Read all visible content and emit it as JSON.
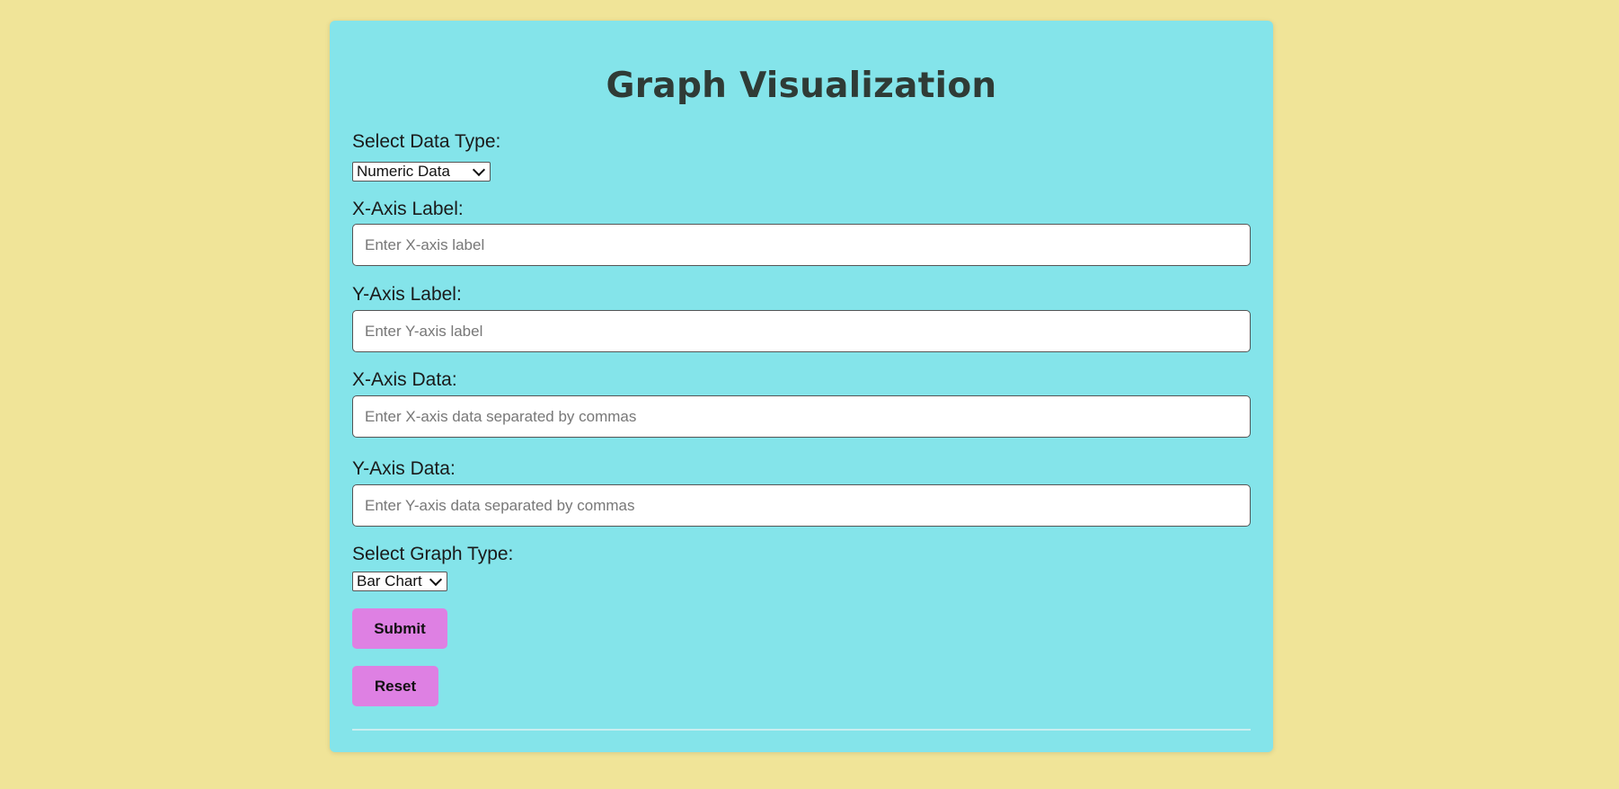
{
  "title": "Graph Visualization",
  "data_type": {
    "label": "Select Data Type:",
    "selected": "Numeric Data"
  },
  "x_label": {
    "label": "X-Axis Label:",
    "placeholder": "Enter X-axis label",
    "value": ""
  },
  "y_label": {
    "label": "Y-Axis Label:",
    "placeholder": "Enter Y-axis label",
    "value": ""
  },
  "x_data": {
    "label": "X-Axis Data:",
    "placeholder": "Enter X-axis data separated by commas",
    "value": ""
  },
  "y_data": {
    "label": "Y-Axis Data:",
    "placeholder": "Enter Y-axis data separated by commas",
    "value": ""
  },
  "graph_type": {
    "label": "Select Graph Type:",
    "selected": "Bar Chart"
  },
  "buttons": {
    "submit": "Submit",
    "reset": "Reset"
  },
  "colors": {
    "page_background": "#f0e498",
    "card_background": "#84e4ea",
    "button_background": "#de80e3",
    "title_color": "#2f3b36"
  }
}
